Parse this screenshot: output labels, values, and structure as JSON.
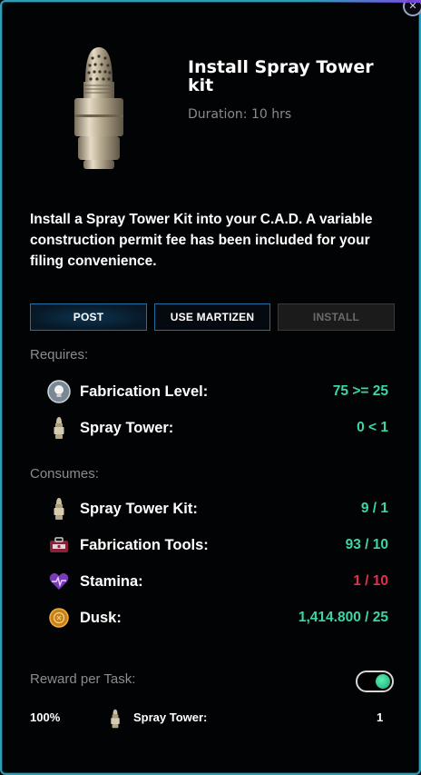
{
  "task": {
    "title": "Install Spray Tower kit",
    "duration": "Duration: 10 hrs",
    "description": "Install a Spray Tower Kit into your C.A.D. A variable construction permit fee has been included for your filing convenience."
  },
  "buttons": {
    "post": "POST",
    "use_martizen": "USE MARTIZEN",
    "install": "INSTALL"
  },
  "requires": {
    "heading": "Requires:",
    "items": [
      {
        "icon": "lightbulb-icon",
        "label": "Fabrication Level:",
        "value": "75 >= 25",
        "status": "green"
      },
      {
        "icon": "spray-tower-icon",
        "label": "Spray Tower:",
        "value": "0 < 1",
        "status": "green"
      }
    ]
  },
  "consumes": {
    "heading": "Consumes:",
    "items": [
      {
        "icon": "spray-tower-kit-icon",
        "label": "Spray Tower Kit:",
        "value": "9 / 1",
        "status": "green"
      },
      {
        "icon": "toolbox-icon",
        "label": "Fabrication Tools:",
        "value": "93 / 10",
        "status": "green"
      },
      {
        "icon": "heart-icon",
        "label": "Stamina:",
        "value": "1 / 10",
        "status": "red"
      },
      {
        "icon": "coin-icon",
        "label": "Dusk:",
        "value": "1,414.800 / 25",
        "status": "green"
      }
    ]
  },
  "reward": {
    "heading": "Reward per Task:",
    "toggle_on": true,
    "items": [
      {
        "chance": "100%",
        "icon": "spray-tower-icon",
        "label": "Spray Tower:",
        "quantity": "1"
      }
    ]
  },
  "colors": {
    "green": "#3bd6a2",
    "red": "#e0304e",
    "border": "#2a9fb8",
    "accent": "#1f6fa0"
  }
}
